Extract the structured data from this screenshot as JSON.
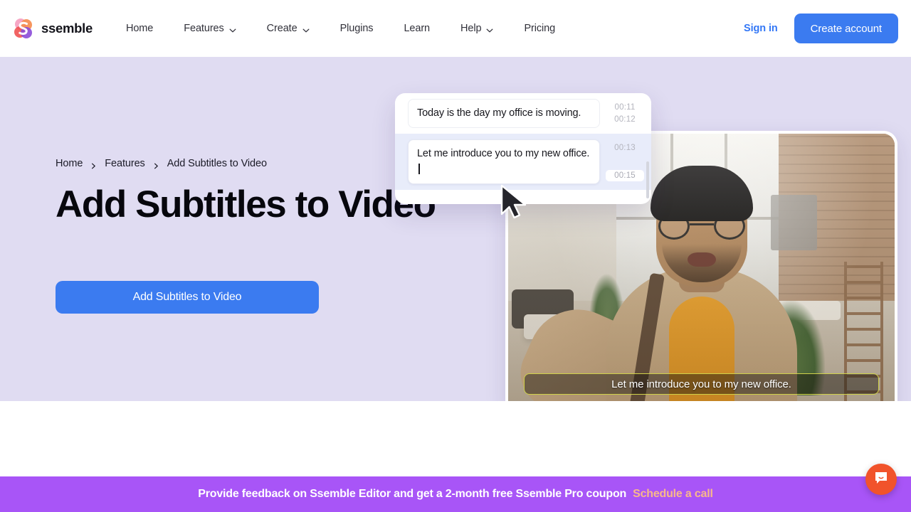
{
  "navbar": {
    "brand": "ssemble",
    "brand_icon": "ssemble-logo-icon",
    "links": [
      {
        "label": "Home",
        "has_dropdown": false
      },
      {
        "label": "Features",
        "has_dropdown": true
      },
      {
        "label": "Create",
        "has_dropdown": true
      },
      {
        "label": "Plugins",
        "has_dropdown": false
      },
      {
        "label": "Learn",
        "has_dropdown": false
      },
      {
        "label": "Help",
        "has_dropdown": true
      },
      {
        "label": "Pricing",
        "has_dropdown": false
      }
    ],
    "sign_in": "Sign in",
    "create_account": "Create account",
    "accent_blue": "#3b7bf0"
  },
  "hero": {
    "background": "#e0dcf2",
    "breadcrumb": [
      {
        "label": "Home"
      },
      {
        "label": "Features"
      },
      {
        "label": "Add Subtitles to Video"
      }
    ],
    "title": "Add Subtitles to Video",
    "cta_label": "Add Subtitles to Video"
  },
  "subtitle_editor": {
    "rows": [
      {
        "text": "Today is the day my office is moving.",
        "start": "00:11",
        "end": "00:12",
        "active": false,
        "editing_end": false
      },
      {
        "text": "Let me introduce you to my new office.",
        "start": "00:13",
        "end": "00:15",
        "active": true,
        "editing_end": true
      }
    ]
  },
  "video_preview": {
    "caption": "Let me introduce you to my new office.",
    "caption_border_color": "#cfd14a"
  },
  "banner": {
    "text": "Provide feedback on Ssemble Editor and get a 2-month free Ssemble Pro coupon",
    "link": "Schedule a call",
    "background": "#a855f7",
    "link_color": "#f8b88b"
  },
  "chat_widget": {
    "icon": "chat-bubble-icon",
    "background": "#f1532b"
  }
}
